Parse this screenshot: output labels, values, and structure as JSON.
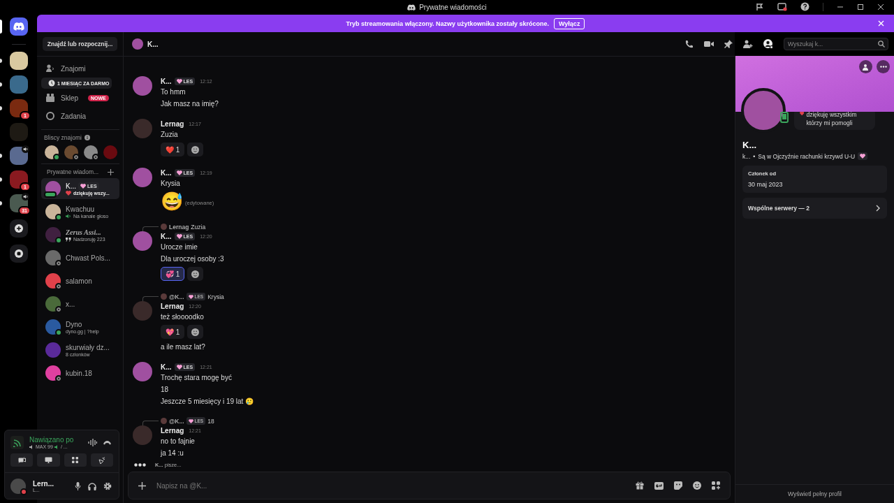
{
  "window": {
    "title": "Prywatne wiadomości"
  },
  "banner": {
    "text": "Tryb streamowania włączony. Nazwy użytkownika zostały skrócone.",
    "button": "Wyłącz"
  },
  "servers": [
    {
      "color": "#d9c9a0",
      "unread": true,
      "voice": false
    },
    {
      "color": "#3a6a8c",
      "unread": true,
      "voice": false
    },
    {
      "color": "#7a2a10",
      "unread": true,
      "voice": false,
      "badge": "1"
    },
    {
      "color": "#1e1a14",
      "unread": false,
      "voice": false
    },
    {
      "color": "#5a6a90",
      "unread": true,
      "voice": true
    },
    {
      "color": "#8a1a20",
      "unread": true,
      "voice": false,
      "badge": "1"
    },
    {
      "color": "#4a5a50",
      "unread": true,
      "voice": true,
      "badge": "31"
    }
  ],
  "sidebar": {
    "search": "Znajdź lub rozpocznij...",
    "nav": [
      {
        "kind": "friends",
        "label": "Znajomi"
      },
      {
        "kind": "promo",
        "label": "1 MIESIĄC ZA DARMO"
      },
      {
        "kind": "shop",
        "label": "Sklep",
        "badge": "NOWE"
      },
      {
        "kind": "quests",
        "label": "Zadania"
      }
    ],
    "close_friends": {
      "title": "Bliscy znajomi",
      "avatars": [
        {
          "color": "#c9b49a",
          "online": true
        },
        {
          "color": "#6a4a30",
          "online": false
        },
        {
          "color": "#8a8a8a",
          "online": false
        },
        {
          "color": "#6a0a10"
        }
      ]
    },
    "dm_header": "Prywatne wiadom...",
    "dms": [
      {
        "kind": "status",
        "name": "K...",
        "tag": "LES",
        "subtitle": "dziękuję wszy...",
        "typing": true,
        "color": "#a050a0",
        "selected": true,
        "italic": false
      },
      {
        "kind": "voice",
        "name": "Kwachuu",
        "subtitle": "Na kanale głoso",
        "online": true,
        "color": "#c9b49a",
        "selected": false,
        "italic": false
      },
      {
        "kind": "activity",
        "name": "Zerus Assi...",
        "subtitle": "Nadzoruję 223",
        "online": true,
        "color": "#402040",
        "selected": false,
        "italic": true
      },
      {
        "name": "Chwast Pols...",
        "online": false,
        "color": "#6a6a6a",
        "selected": false,
        "italic": false
      },
      {
        "name": "salamon",
        "online": false,
        "color": "#e0414a",
        "selected": false,
        "italic": false
      },
      {
        "name": "x...",
        "online": false,
        "color": "#4a6a3a",
        "selected": false,
        "italic": false
      },
      {
        "kind": "plain",
        "name": "Dyno",
        "subtitle": "dyno.gg | ?help",
        "online": true,
        "color": "#2a5aa0",
        "selected": false,
        "italic": false
      },
      {
        "kind": "plain",
        "name": "skurwiały dz...",
        "subtitle": "8 członków",
        "color": "#5a2a9a",
        "selected": false,
        "italic": false
      },
      {
        "name": "kubin.18",
        "online": false,
        "color": "#e040a0",
        "selected": false,
        "italic": false
      }
    ]
  },
  "voice_panel": {
    "status": "Nawiązano po",
    "detail_a": "MAX 99",
    "detail_b": "/ ..."
  },
  "user": {
    "name": "Lern...",
    "subtitle": "L...",
    "dnd": true,
    "color": "#4a4a4a"
  },
  "chat": {
    "title": "K...",
    "search": {
      "placeholder": "Wyszukaj k..."
    },
    "messages": [
      {
        "author": "K...",
        "tag": "LES",
        "time": "12:12",
        "color": "#a050a0",
        "items": [
          {
            "kind": "text",
            "text": "To hmm"
          },
          {
            "kind": "text",
            "text": "Jak masz na imię?"
          }
        ]
      },
      {
        "author": "Lernag",
        "time": "12:17",
        "color": "#3a2a2a",
        "items": [
          {
            "kind": "text",
            "text": "Zuzia"
          },
          {
            "kind": "reactions",
            "reactions": [
              {
                "emoji": "❤️",
                "count": "1",
                "selected": false
              }
            ]
          }
        ]
      },
      {
        "author": "K...",
        "tag": "LES",
        "time": "12:19",
        "color": "#a050a0",
        "items": [
          {
            "kind": "text",
            "text": "Krysia"
          },
          {
            "kind": "jumbo",
            "emoji": "😅",
            "note": "(edytowane)"
          }
        ]
      },
      {
        "author": "K...",
        "tag": "LES",
        "time": "12:20",
        "color": "#a050a0",
        "reply": {
          "author": "Lernag",
          "text": "Zuzia"
        },
        "items": [
          {
            "kind": "text",
            "text": "Urocze imie"
          },
          {
            "kind": "text",
            "text": "Dla uroczej osoby :3"
          },
          {
            "kind": "reactions",
            "reactions": [
              {
                "emoji": "💞",
                "count": "1",
                "selected": true
              }
            ]
          }
        ]
      },
      {
        "author": "Lernag",
        "time": "12:20",
        "color": "#3a2a2a",
        "reply": {
          "author": "@K...",
          "tag": "LES",
          "text": "Krysia"
        },
        "items": [
          {
            "kind": "text",
            "text": "też słoooodko"
          },
          {
            "kind": "reactions",
            "reactions": [
              {
                "emoji": "💖",
                "count": "1",
                "selected": false
              }
            ]
          },
          {
            "kind": "text",
            "text": "a ile masz lat?"
          }
        ]
      },
      {
        "author": "K...",
        "tag": "LES",
        "time": "12:21",
        "color": "#a050a0",
        "items": [
          {
            "kind": "text",
            "text": "Trochę stara mogę być"
          },
          {
            "kind": "text",
            "text": "18"
          },
          {
            "kind": "text",
            "text": "Jeszcze 5 miesięcy i 19 lat 🥲"
          }
        ]
      },
      {
        "author": "Lernag",
        "time": "12:21",
        "color": "#3a2a2a",
        "reply": {
          "author": "@K...",
          "tag": "LES",
          "text": "18"
        },
        "items": [
          {
            "kind": "text",
            "text": "no to fajnie"
          },
          {
            "kind": "text",
            "text": "ja 14 :u"
          }
        ]
      }
    ],
    "typing": "**K...** pisze...",
    "composer": {
      "placeholder": "Napisz na @K..."
    }
  },
  "profile": {
    "status_text": "dziękuję wszystkim którzy mi pomogli",
    "name": "K...",
    "username": "k...",
    "separator": "•",
    "bio": "Są w Ojczyźnie rachunki krzywd U-U",
    "member_label": "Członek od",
    "member_since": "30 maj 2023",
    "mutual": "Wspólne serwery — 2",
    "footer": "Wyświetl pełny profil"
  }
}
